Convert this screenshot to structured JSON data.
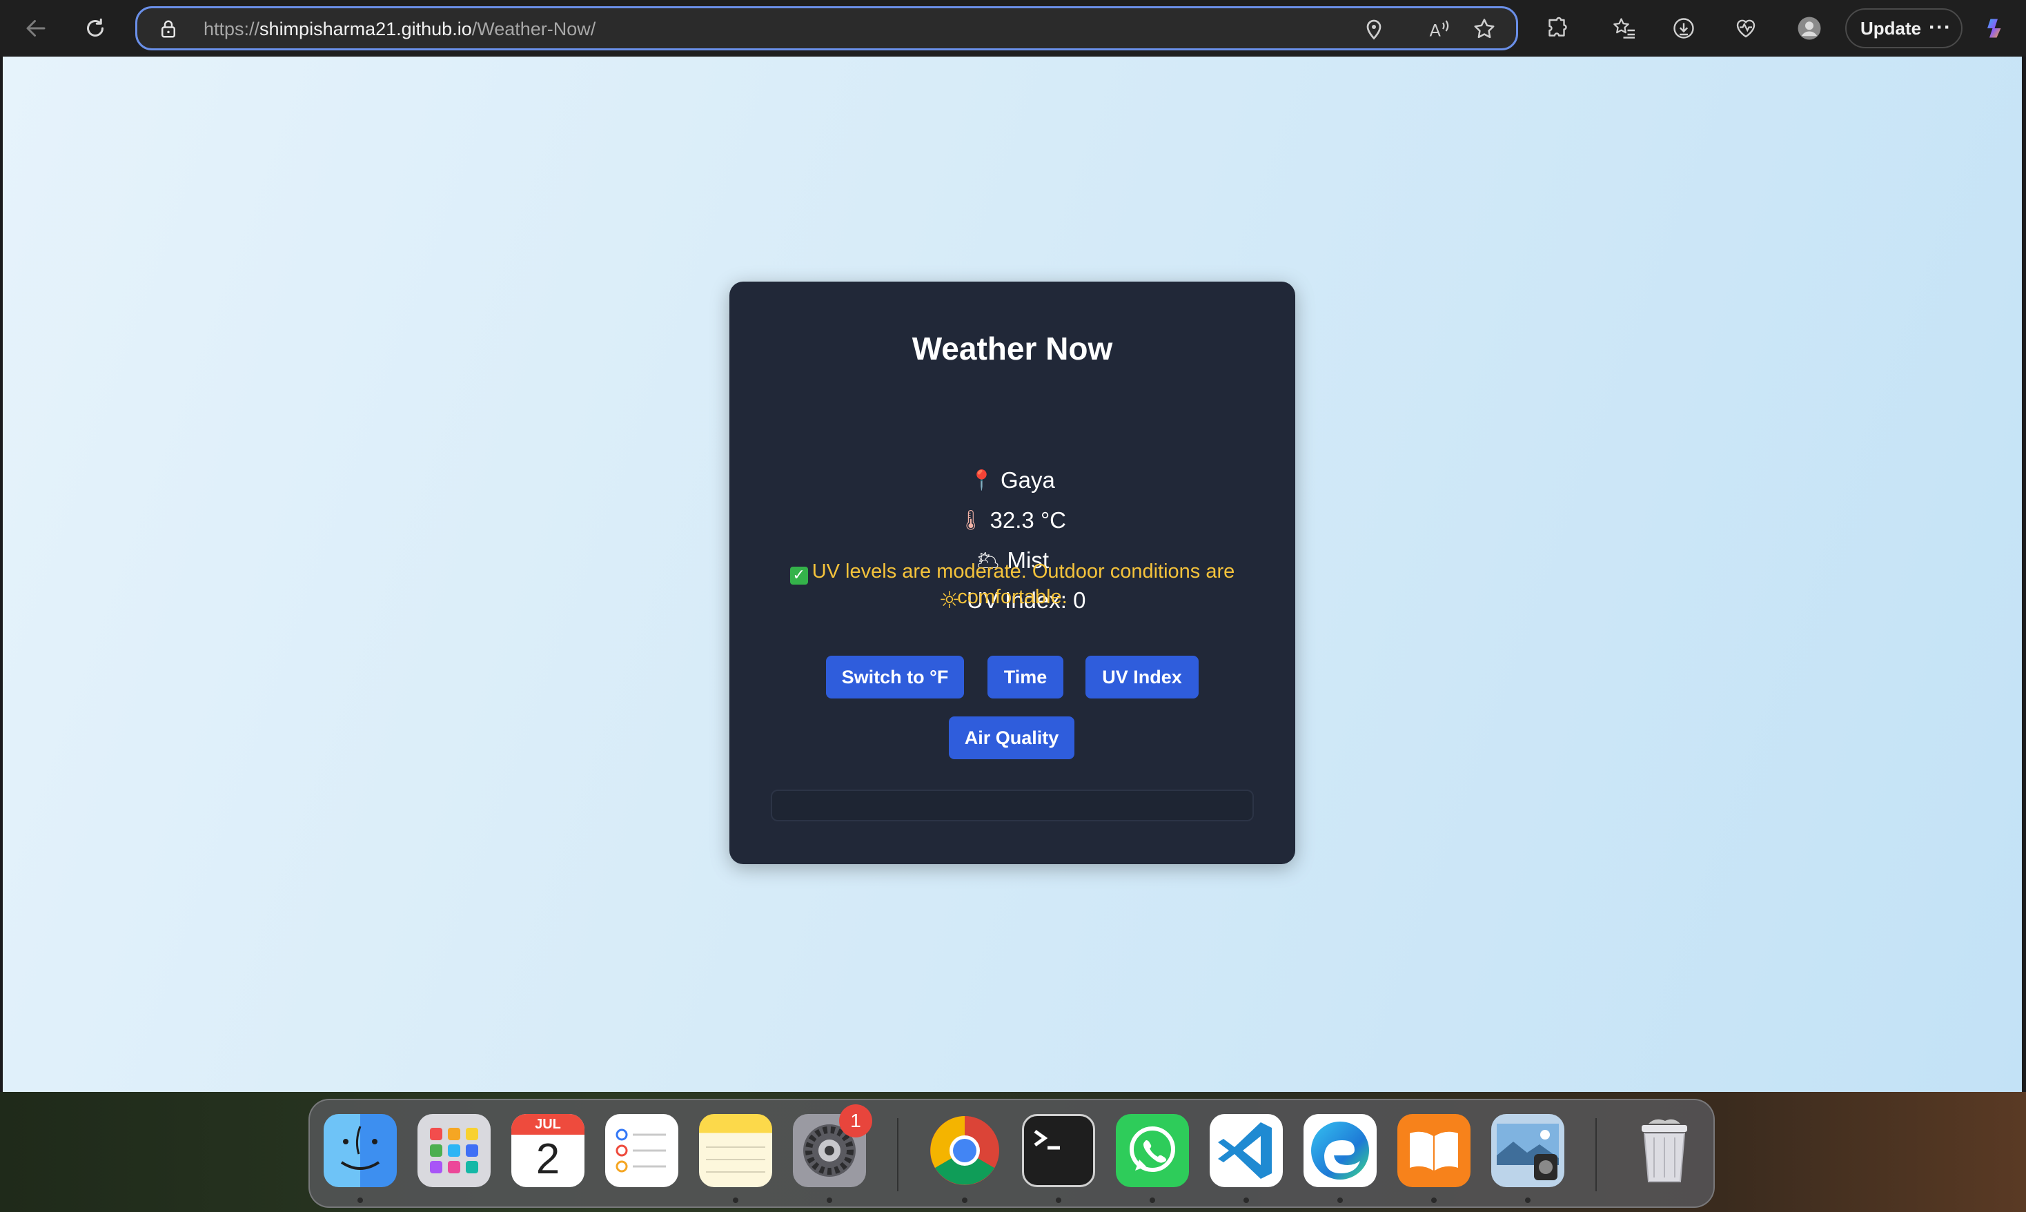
{
  "browser": {
    "url_prefix": "https://",
    "url_host": "shimpisharma21.github.io",
    "url_path": "/Weather-Now/",
    "update_label": "Update",
    "more_label": "···"
  },
  "weather": {
    "title": "Weather Now",
    "location_emoji": "📍",
    "location": "Gaya",
    "temp_emoji": "🌡",
    "temperature": "32.3 °C",
    "condition_emoji": "🌥",
    "condition": "Mist",
    "uv_emoji": "☼",
    "uv_label": "UV Index: 0",
    "uv_check": "✓",
    "uv_message": "UV levels are moderate. Outdoor conditions are comfortable.",
    "buttons": {
      "switch_unit": "Switch to °F",
      "time": "Time",
      "uv_index": "UV Index",
      "air_quality": "Air Quality"
    },
    "result": ""
  },
  "dock": {
    "calendar_month": "JUL",
    "calendar_day": "2",
    "settings_badge": "1",
    "apps": [
      "finder",
      "launchpad",
      "calendar",
      "reminders",
      "notes",
      "system-settings",
      "chrome",
      "terminal",
      "whatsapp",
      "vscode",
      "edge",
      "books",
      "preview",
      "trash"
    ]
  },
  "colors": {
    "card_bg": "#212838",
    "button_bg": "#2f5ddc",
    "uv_note": "#f5c33b",
    "address_border": "#6a8fe8"
  }
}
